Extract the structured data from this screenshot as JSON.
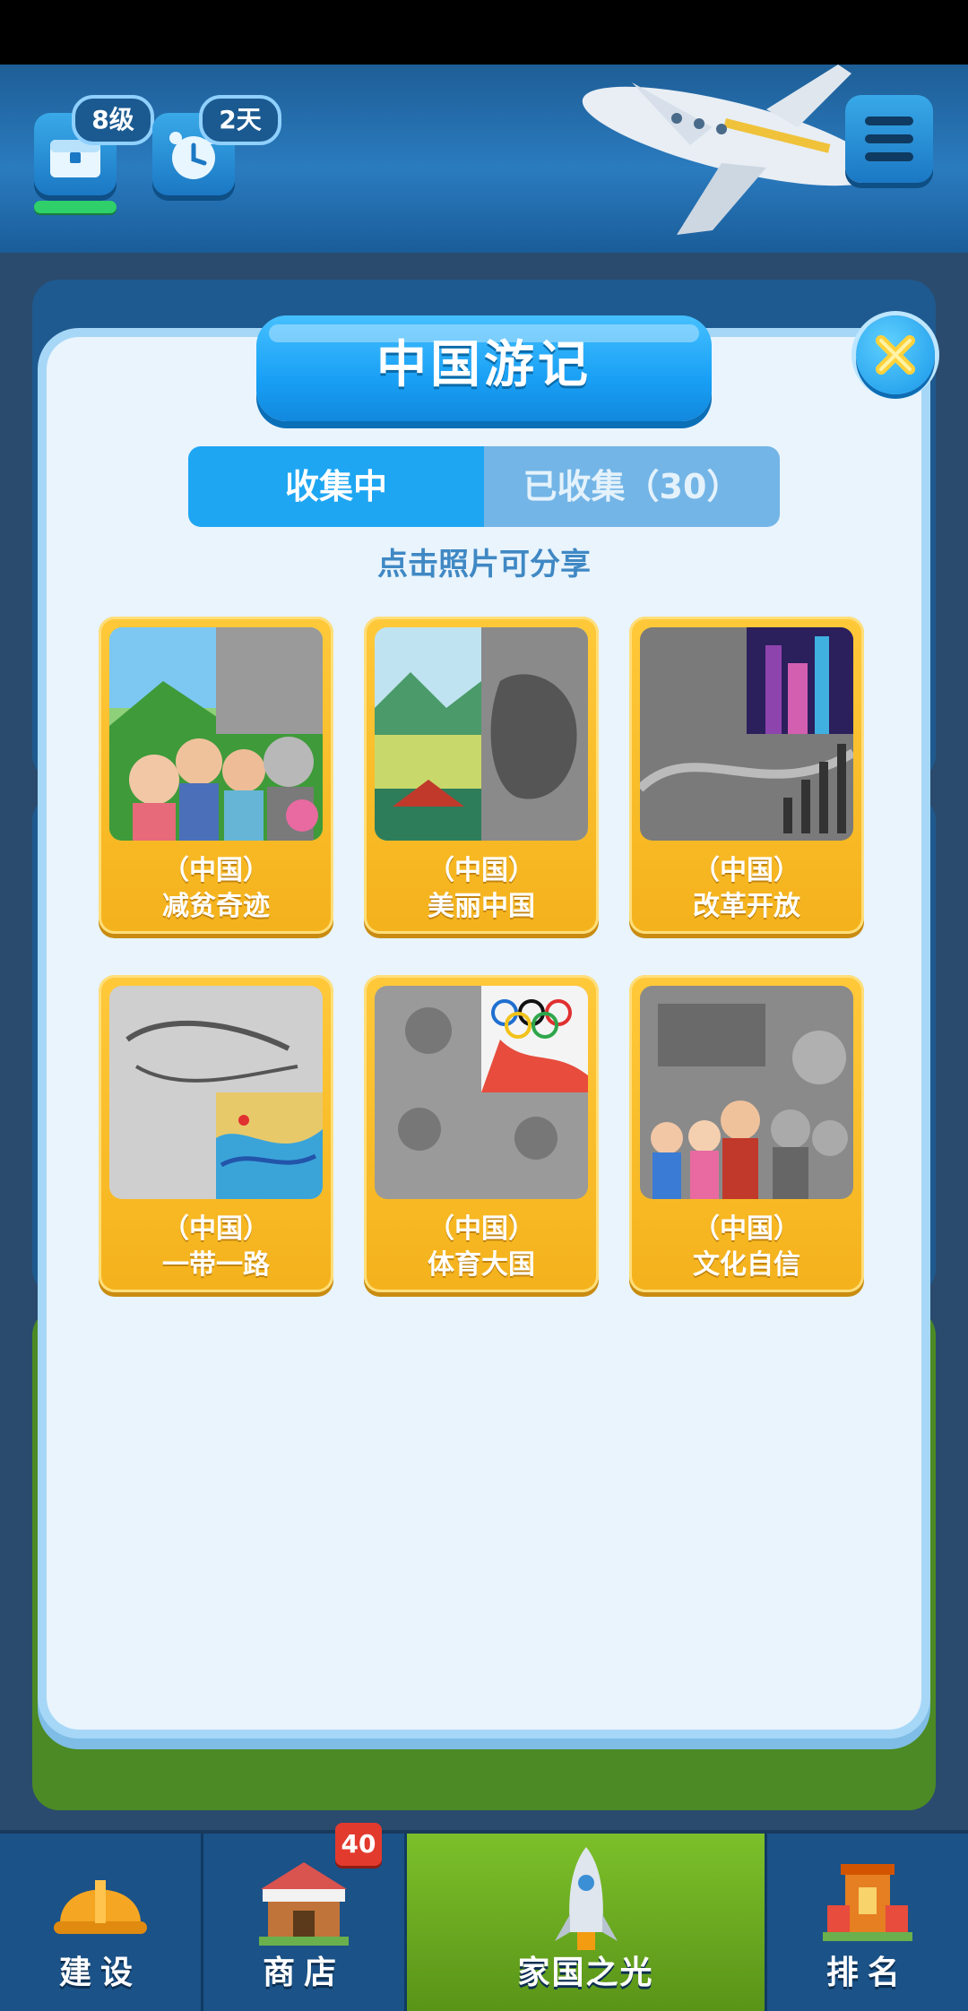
{
  "hud": {
    "level_badge": "8级",
    "time_badge": "2天"
  },
  "modal": {
    "title": "中国游记",
    "tabs": [
      {
        "label": "收集中"
      },
      {
        "label": "已收集（30）"
      }
    ],
    "hint": "点击照片可分享",
    "cards": [
      {
        "country": "（中国）",
        "name": "减贫奇迹"
      },
      {
        "country": "（中国）",
        "name": "美丽中国"
      },
      {
        "country": "（中国）",
        "name": "改革开放"
      },
      {
        "country": "（中国）",
        "name": "一带一路"
      },
      {
        "country": "（中国）",
        "name": "体育大国"
      },
      {
        "country": "（中国）",
        "name": "文化自信"
      }
    ]
  },
  "nav": {
    "items": [
      {
        "label": "建设"
      },
      {
        "label": "商店"
      },
      {
        "label": "家国之光"
      },
      {
        "label": "排名"
      }
    ],
    "shop_badge": "40"
  },
  "icons": {
    "close": "close-icon",
    "menu": "menu-icon",
    "treasure": "treasure-chest-icon",
    "clock": "alarm-clock-icon",
    "helmet": "hard-hat-icon",
    "shop": "shop-icon",
    "rocket": "rocket-icon",
    "rank": "ranking-building-icon"
  },
  "colors": {
    "accent": "#1ea6f2",
    "card": "#ffc93a",
    "modal_bg": "#e9f4fd",
    "nav_active": "#6ba71d"
  }
}
